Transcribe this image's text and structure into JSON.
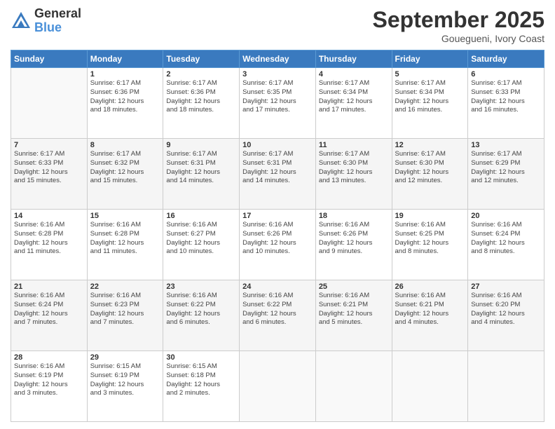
{
  "header": {
    "logo_line1": "General",
    "logo_line2": "Blue",
    "month": "September 2025",
    "location": "Gouegueni, Ivory Coast"
  },
  "weekdays": [
    "Sunday",
    "Monday",
    "Tuesday",
    "Wednesday",
    "Thursday",
    "Friday",
    "Saturday"
  ],
  "weeks": [
    [
      {
        "day": "",
        "text": ""
      },
      {
        "day": "1",
        "text": "Sunrise: 6:17 AM\nSunset: 6:36 PM\nDaylight: 12 hours\nand 18 minutes."
      },
      {
        "day": "2",
        "text": "Sunrise: 6:17 AM\nSunset: 6:36 PM\nDaylight: 12 hours\nand 18 minutes."
      },
      {
        "day": "3",
        "text": "Sunrise: 6:17 AM\nSunset: 6:35 PM\nDaylight: 12 hours\nand 17 minutes."
      },
      {
        "day": "4",
        "text": "Sunrise: 6:17 AM\nSunset: 6:34 PM\nDaylight: 12 hours\nand 17 minutes."
      },
      {
        "day": "5",
        "text": "Sunrise: 6:17 AM\nSunset: 6:34 PM\nDaylight: 12 hours\nand 16 minutes."
      },
      {
        "day": "6",
        "text": "Sunrise: 6:17 AM\nSunset: 6:33 PM\nDaylight: 12 hours\nand 16 minutes."
      }
    ],
    [
      {
        "day": "7",
        "text": "Sunrise: 6:17 AM\nSunset: 6:33 PM\nDaylight: 12 hours\nand 15 minutes."
      },
      {
        "day": "8",
        "text": "Sunrise: 6:17 AM\nSunset: 6:32 PM\nDaylight: 12 hours\nand 15 minutes."
      },
      {
        "day": "9",
        "text": "Sunrise: 6:17 AM\nSunset: 6:31 PM\nDaylight: 12 hours\nand 14 minutes."
      },
      {
        "day": "10",
        "text": "Sunrise: 6:17 AM\nSunset: 6:31 PM\nDaylight: 12 hours\nand 14 minutes."
      },
      {
        "day": "11",
        "text": "Sunrise: 6:17 AM\nSunset: 6:30 PM\nDaylight: 12 hours\nand 13 minutes."
      },
      {
        "day": "12",
        "text": "Sunrise: 6:17 AM\nSunset: 6:30 PM\nDaylight: 12 hours\nand 12 minutes."
      },
      {
        "day": "13",
        "text": "Sunrise: 6:17 AM\nSunset: 6:29 PM\nDaylight: 12 hours\nand 12 minutes."
      }
    ],
    [
      {
        "day": "14",
        "text": "Sunrise: 6:16 AM\nSunset: 6:28 PM\nDaylight: 12 hours\nand 11 minutes."
      },
      {
        "day": "15",
        "text": "Sunrise: 6:16 AM\nSunset: 6:28 PM\nDaylight: 12 hours\nand 11 minutes."
      },
      {
        "day": "16",
        "text": "Sunrise: 6:16 AM\nSunset: 6:27 PM\nDaylight: 12 hours\nand 10 minutes."
      },
      {
        "day": "17",
        "text": "Sunrise: 6:16 AM\nSunset: 6:26 PM\nDaylight: 12 hours\nand 10 minutes."
      },
      {
        "day": "18",
        "text": "Sunrise: 6:16 AM\nSunset: 6:26 PM\nDaylight: 12 hours\nand 9 minutes."
      },
      {
        "day": "19",
        "text": "Sunrise: 6:16 AM\nSunset: 6:25 PM\nDaylight: 12 hours\nand 8 minutes."
      },
      {
        "day": "20",
        "text": "Sunrise: 6:16 AM\nSunset: 6:24 PM\nDaylight: 12 hours\nand 8 minutes."
      }
    ],
    [
      {
        "day": "21",
        "text": "Sunrise: 6:16 AM\nSunset: 6:24 PM\nDaylight: 12 hours\nand 7 minutes."
      },
      {
        "day": "22",
        "text": "Sunrise: 6:16 AM\nSunset: 6:23 PM\nDaylight: 12 hours\nand 7 minutes."
      },
      {
        "day": "23",
        "text": "Sunrise: 6:16 AM\nSunset: 6:22 PM\nDaylight: 12 hours\nand 6 minutes."
      },
      {
        "day": "24",
        "text": "Sunrise: 6:16 AM\nSunset: 6:22 PM\nDaylight: 12 hours\nand 6 minutes."
      },
      {
        "day": "25",
        "text": "Sunrise: 6:16 AM\nSunset: 6:21 PM\nDaylight: 12 hours\nand 5 minutes."
      },
      {
        "day": "26",
        "text": "Sunrise: 6:16 AM\nSunset: 6:21 PM\nDaylight: 12 hours\nand 4 minutes."
      },
      {
        "day": "27",
        "text": "Sunrise: 6:16 AM\nSunset: 6:20 PM\nDaylight: 12 hours\nand 4 minutes."
      }
    ],
    [
      {
        "day": "28",
        "text": "Sunrise: 6:16 AM\nSunset: 6:19 PM\nDaylight: 12 hours\nand 3 minutes."
      },
      {
        "day": "29",
        "text": "Sunrise: 6:15 AM\nSunset: 6:19 PM\nDaylight: 12 hours\nand 3 minutes."
      },
      {
        "day": "30",
        "text": "Sunrise: 6:15 AM\nSunset: 6:18 PM\nDaylight: 12 hours\nand 2 minutes."
      },
      {
        "day": "",
        "text": ""
      },
      {
        "day": "",
        "text": ""
      },
      {
        "day": "",
        "text": ""
      },
      {
        "day": "",
        "text": ""
      }
    ]
  ]
}
